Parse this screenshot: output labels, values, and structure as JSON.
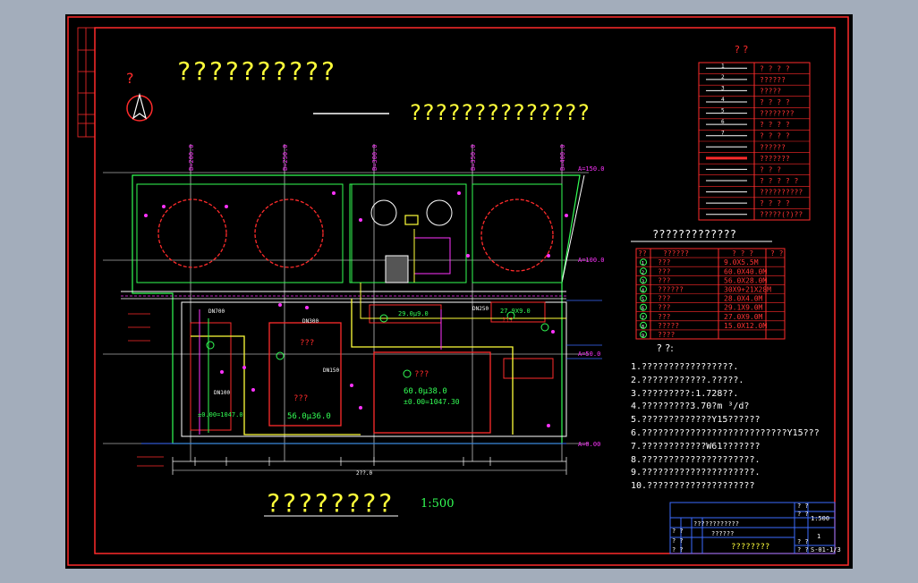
{
  "drawing": {
    "title_top": "??????????",
    "title_right": "??????????????",
    "compass_label": "?",
    "scale_title": "????????",
    "scale": "1:500"
  },
  "axes": {
    "vertical": [
      "B=200.0",
      "B=250.0",
      "B=300.0",
      "B=350.0",
      "B=400.0"
    ],
    "horizontal": [
      "A=150.0",
      "A=100.0",
      "A=50.0",
      "A=0.00"
    ]
  },
  "plan_labels": {
    "building_left": "???",
    "building_left_sub": "???",
    "building_left_dim": "56.0µ36.0",
    "building_left_elev": "±0.00=1047.0",
    "building_right": "???",
    "building_right_dim": "60.0µ38.0",
    "building_right_elev": "±0.00=1047.30",
    "small_building_1": "29.0µ9.0",
    "small_building_2": "27.9X9.0",
    "small_building_3": "???",
    "pipe_dn700": "DN700",
    "pipe_dn250": "DN250",
    "pipe_dn100": "DN100",
    "pipe_dn150": "DN150",
    "pipe_dn300": "DN300",
    "bottom_dim": "2??.0"
  },
  "legend": {
    "heading": "? ?",
    "rows": [
      {
        "code": "1",
        "label": "? ? ? ?",
        "color": "#ff3333"
      },
      {
        "code": "2",
        "label": "??????",
        "color": "#ff3333"
      },
      {
        "code": "3",
        "label": "?????",
        "color": "#ff3333"
      },
      {
        "code": "4",
        "label": "? ? ? ?",
        "color": "#ff3333"
      },
      {
        "code": "5",
        "label": "????????",
        "color": "#ff3333"
      },
      {
        "code": "6",
        "label": "? ? ? ?",
        "color": "#ff3333"
      },
      {
        "code": "7",
        "label": "? ? ? ?",
        "color": "#ff3333"
      },
      {
        "code": "",
        "label": "??????",
        "color": "#ff3333"
      },
      {
        "code": "",
        "label": "???????",
        "color": "#ff3333"
      },
      {
        "code": "",
        "label": "? ? ?",
        "color": "#ff3333"
      },
      {
        "code": "",
        "label": "? ? ? ? ?",
        "color": "#ff3333"
      },
      {
        "code": "",
        "label": "??????????",
        "color": "#ff3333"
      },
      {
        "code": "",
        "label": "? ? ? ?",
        "color": "#ff3333"
      },
      {
        "code": "",
        "label": "?????(?)??",
        "color": "#ff3333"
      }
    ]
  },
  "building_table": {
    "heading": "?????????????",
    "header": [
      "??",
      "??????",
      "? ? ?",
      "?  ?"
    ],
    "rows": [
      {
        "no": "1",
        "name": "???",
        "size": "9.0X5.5M"
      },
      {
        "no": "2",
        "name": "???",
        "size": "60.0X40.0M"
      },
      {
        "no": "3",
        "name": "???",
        "size": "56.0X28.0M"
      },
      {
        "no": "4",
        "name": "??????",
        "size": "30X9+21X28M"
      },
      {
        "no": "5",
        "name": "???",
        "size": "28.0X4.0M"
      },
      {
        "no": "6",
        "name": "???",
        "size": "29.1X9.0M"
      },
      {
        "no": "7",
        "name": "???",
        "size": "27.0X9.0M"
      },
      {
        "no": "8",
        "name": "?????",
        "size": "15.0X12.0M"
      },
      {
        "no": "9",
        "name": "????",
        "size": ""
      }
    ]
  },
  "notes": {
    "heading": "? ?:",
    "items": [
      "1.?????????????????.",
      "2.????????????.?????.",
      "3.?????????:1.728??.",
      "4.?????????3.70?m ³/d?",
      "5.?????????????Y15??????",
      "6.???????????????????????????Y15???",
      "7.????????????W61???????",
      "8.?????????????????????.",
      "9.?????????????????????.",
      "10.????????????????????"
    ]
  },
  "title_block": {
    "project": "?????????",
    "drawing_name": "??????",
    "sheet_title": "????????",
    "scale_value": "1:500",
    "sheet_no": "S-01-1/3",
    "cells": [
      "? ?",
      "? ?",
      "? ?",
      "? ?",
      "? ?",
      "???",
      "? ?",
      "? ?",
      "1"
    ]
  }
}
